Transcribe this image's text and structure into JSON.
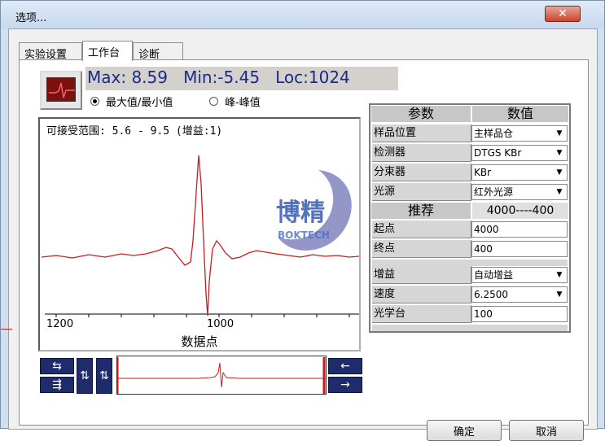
{
  "window": {
    "title": "选项...",
    "close_glyph": "✕"
  },
  "tabs": [
    {
      "label": "实验设置",
      "active": false
    },
    {
      "label": "工作台",
      "active": true
    },
    {
      "label": "诊断",
      "active": false
    }
  ],
  "readout": {
    "max": "Max: 8.59",
    "min": "Min:-5.45",
    "loc": "Loc:1024"
  },
  "mode": {
    "option1": "最大值/最小值",
    "option2": "峰-峰值",
    "selected": "option1"
  },
  "plot": {
    "range_text": "可接受范围: 5.6 - 9.5  (增益:1)",
    "xtick1": "1200",
    "xtick2": "1000",
    "xlabel": "数据点",
    "line_color": "#c41e1e"
  },
  "logo": {
    "main": "博精",
    "sub": "BOKTECH"
  },
  "params": {
    "header_param": "参数",
    "header_value": "数值",
    "rows": [
      {
        "label": "样品位置",
        "value": "主样品仓"
      },
      {
        "label": "检测器",
        "value": "DTGS KBr"
      },
      {
        "label": "分束器",
        "value": "KBr"
      },
      {
        "label": "光源",
        "value": "红外光源"
      }
    ],
    "recommend_label": "推荐",
    "recommend_value": "4000----400",
    "start_label": "起点",
    "start_value": "4000",
    "end_label": "终点",
    "end_value": "400",
    "gain_label": "增益",
    "gain_value": "自动增益",
    "speed_label": "速度",
    "speed_value": "6.2500",
    "bench_label": "光学台",
    "bench_value": "100"
  },
  "nav": {
    "left_right": "⇆",
    "up_down": "⇅",
    "collapse": "⇶",
    "prev": "←",
    "next": "→"
  },
  "buttons": {
    "ok": "确定",
    "cancel": "取消"
  }
}
